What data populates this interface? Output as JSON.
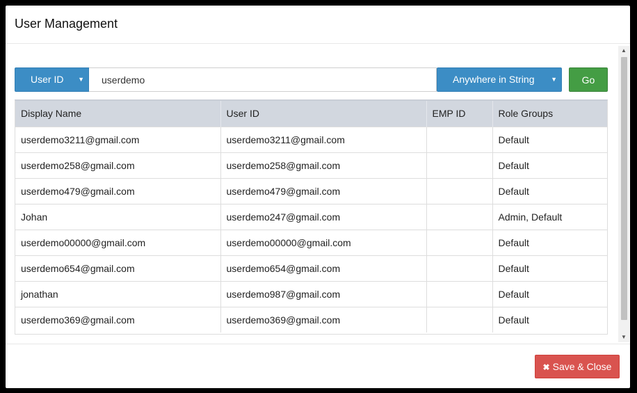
{
  "dialog": {
    "title": "User Management"
  },
  "search": {
    "field_option": "User ID",
    "query_value": "userdemo",
    "match_option": "Anywhere in String",
    "go_label": "Go"
  },
  "table": {
    "headers": [
      "Display Name",
      "User ID",
      "EMP ID",
      "Role Groups"
    ],
    "rows": [
      [
        "userdemo3211@gmail.com",
        "userdemo3211@gmail.com",
        "",
        "Default"
      ],
      [
        "userdemo258@gmail.com",
        "userdemo258@gmail.com",
        "",
        "Default"
      ],
      [
        "userdemo479@gmail.com",
        "userdemo479@gmail.com",
        "",
        "Default"
      ],
      [
        "Johan",
        "userdemo247@gmail.com",
        "",
        "Admin, Default"
      ],
      [
        "userdemo00000@gmail.com",
        "userdemo00000@gmail.com",
        "",
        "Default"
      ],
      [
        "userdemo654@gmail.com",
        "userdemo654@gmail.com",
        "",
        "Default"
      ],
      [
        "jonathan",
        "userdemo987@gmail.com",
        "",
        "Default"
      ],
      [
        "userdemo369@gmail.com",
        "userdemo369@gmail.com",
        "",
        "Default"
      ]
    ]
  },
  "footer": {
    "save_close_label": "Save & Close"
  },
  "icons": {
    "dropdown": "caret-down-icon",
    "save_close": "close-x-icon",
    "scroll_up": "scroll-up-arrow-icon",
    "scroll_down": "scroll-down-arrow-icon"
  },
  "colors": {
    "select_blue": "#3c8dc5",
    "go_green": "#449d44",
    "save_red": "#d9534f",
    "table_header": "#d2d7df"
  }
}
